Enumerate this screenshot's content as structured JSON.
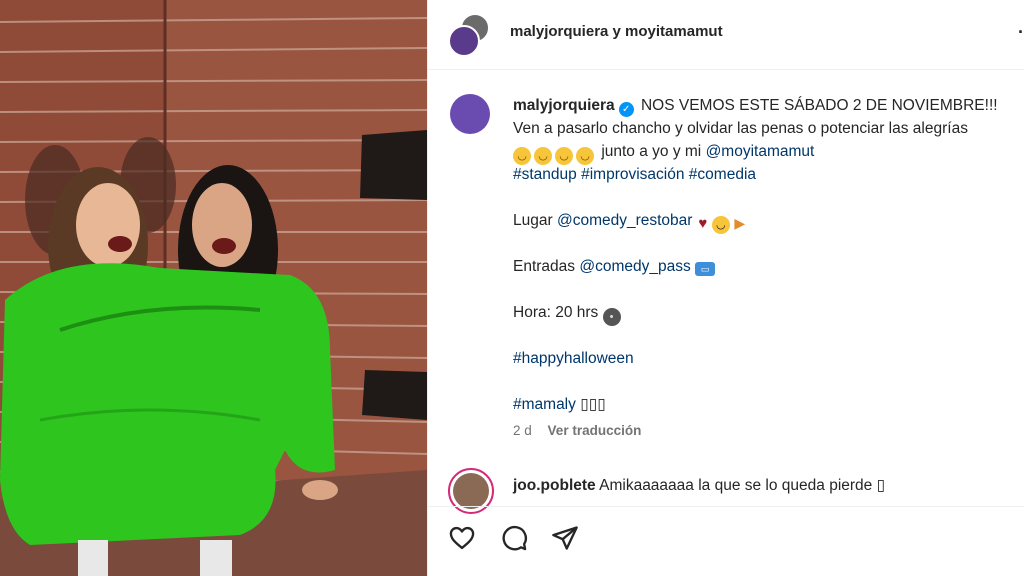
{
  "header": {
    "names": "malyjorquiera y moyitamamut",
    "more": "·"
  },
  "caption": {
    "username": "malyjorquiera",
    "title": "NOS VEMOS ESTE SÁBADO 2 DE NOVIEMBRE!!!",
    "line2": "Ven a pasarlo chancho y olvidar las penas o potenciar las alegrías",
    "line3_text": "junto a yo y mi",
    "line3_mention": "@moyitamamut",
    "hashtags": [
      "#standup",
      "#improvisación",
      "#comedia"
    ],
    "lugar_label": "Lugar",
    "lugar_mention": "@comedy_restobar",
    "entradas_label": "Entradas",
    "entradas_mention": "@comedy_pass",
    "hora": "Hora: 20 hrs",
    "tag_halloween": "#happyhalloween",
    "tag_mamaly": "#mamaly",
    "tag_mamaly_suffix": "▯▯▯",
    "time_ago": "2 d",
    "see_translation": "Ver traducción"
  },
  "comment": {
    "username": "joo.poblete",
    "text": "Amikaaaaaaa la que se lo queda pierde",
    "suffix": "▯"
  },
  "icons": {
    "like": "heart-icon",
    "comment": "comment-icon",
    "share": "send-icon",
    "verified": "verified-badge-icon"
  },
  "colors": {
    "link": "#00376b",
    "verified": "#0095f6",
    "story_ring": "#d62976",
    "meta_text": "#737373"
  }
}
